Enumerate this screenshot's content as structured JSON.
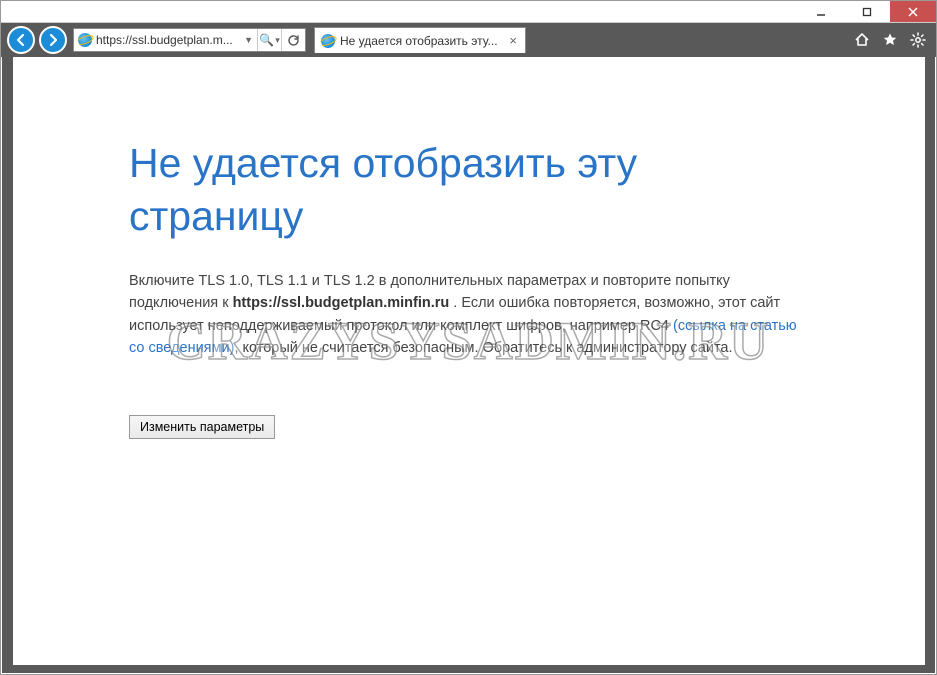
{
  "window": {
    "minimize": "minimize",
    "maximize": "maximize",
    "close": "close"
  },
  "toolbar": {
    "address": "https://ssl.budgetplan.m...",
    "search_glyph": "🔍",
    "refresh_glyph": "↻"
  },
  "tab": {
    "title": "Не удается отобразить эту...",
    "close": "×"
  },
  "page": {
    "heading": "Не удается отобразить эту страницу",
    "body_1": "Включите TLS 1.0, TLS 1.1 и TLS 1.2 в дополнительных параметрах и повторите попытку подключения к ",
    "body_bold": "https://ssl.budgetplan.minfin.ru",
    "body_2": " . Если ошибка повторяется, возможно, этот сайт использует неподдерживаемый протокол или комплект шифров, например RC4 ",
    "body_link": "(ссылка на статью со сведениями)",
    "body_3": ", который не считается безопасным. Обратитесь к администратору сайта.",
    "button": "Изменить параметры"
  },
  "watermark": "CRAZYSYSADMIN.RU"
}
